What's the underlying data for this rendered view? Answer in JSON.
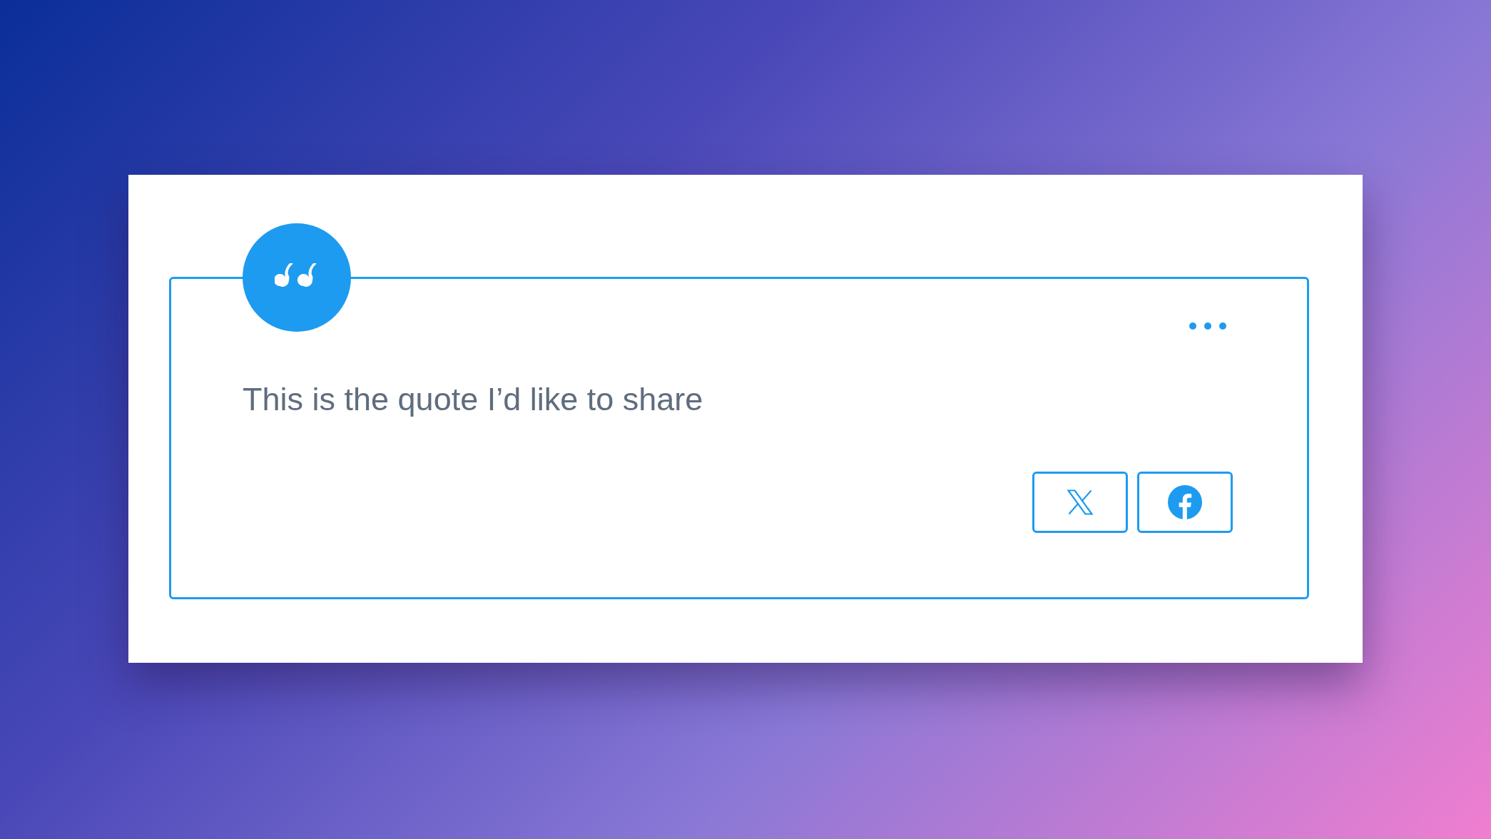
{
  "quote": {
    "text": "This is the quote I’d like to share"
  },
  "share_buttons": [
    {
      "kind": "x"
    },
    {
      "kind": "facebook"
    }
  ]
}
